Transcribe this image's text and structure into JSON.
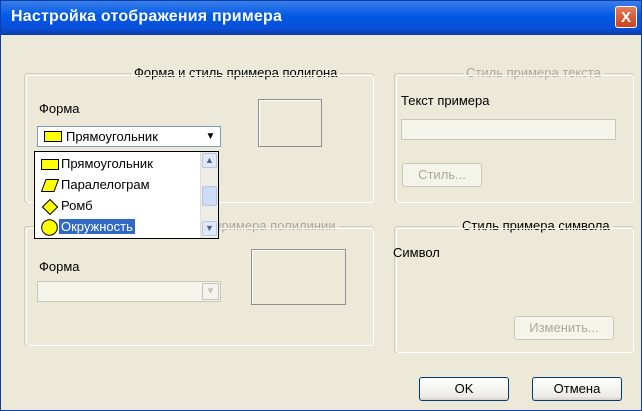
{
  "window": {
    "title": "Настройка отображения примера",
    "close_label": "X"
  },
  "polygon_group": {
    "legend": "Форма и стиль примера полигона",
    "shape_label": "Форма",
    "selected_value": "Прямоугольник",
    "dropdown_items": [
      "Прямоугольник",
      "Паралелограм",
      "Ромб",
      "Окружность"
    ],
    "highlighted_item": "Окружность"
  },
  "text_group": {
    "legend": "Стиль примера текста",
    "text_label": "Текст примера",
    "text_value": "",
    "style_button": "Стиль..."
  },
  "polyline_group": {
    "legend_visible_part": "ь примера полилинии",
    "shape_label": "Форма",
    "selected_value": ""
  },
  "symbol_group": {
    "legend": "Стиль примера символа",
    "symbol_label": "Символ",
    "change_button": "Изменить..."
  },
  "buttons": {
    "ok": "OK",
    "cancel": "Отмена"
  },
  "colors": {
    "shape_fill": "#ffff00",
    "selection": "#316ac5",
    "titlebar": "#0058e6"
  }
}
